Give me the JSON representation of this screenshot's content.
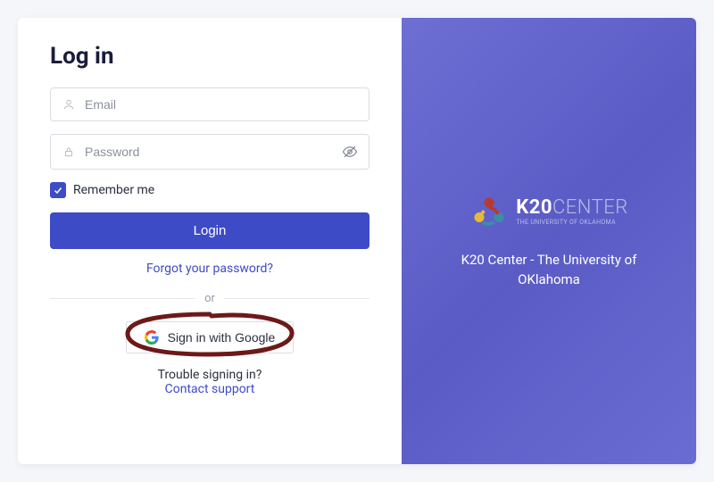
{
  "login": {
    "title": "Log in",
    "email_placeholder": "Email",
    "password_placeholder": "Password",
    "remember_label": "Remember me",
    "login_button": "Login",
    "forgot_link": "Forgot your password?",
    "divider_text": "or",
    "google_button": "Sign in with Google",
    "trouble_text": "Trouble signing in?",
    "contact_link": "Contact support",
    "remember_checked": true
  },
  "brand": {
    "logo_bold": "K20",
    "logo_light": "CENTER",
    "logo_sub": "THE UNIVERSITY OF OKLAHOMA",
    "caption": "K20 Center - The University of OKlahoma"
  },
  "colors": {
    "primary": "#3d4bc7",
    "annotation": "#7a1c1c"
  }
}
